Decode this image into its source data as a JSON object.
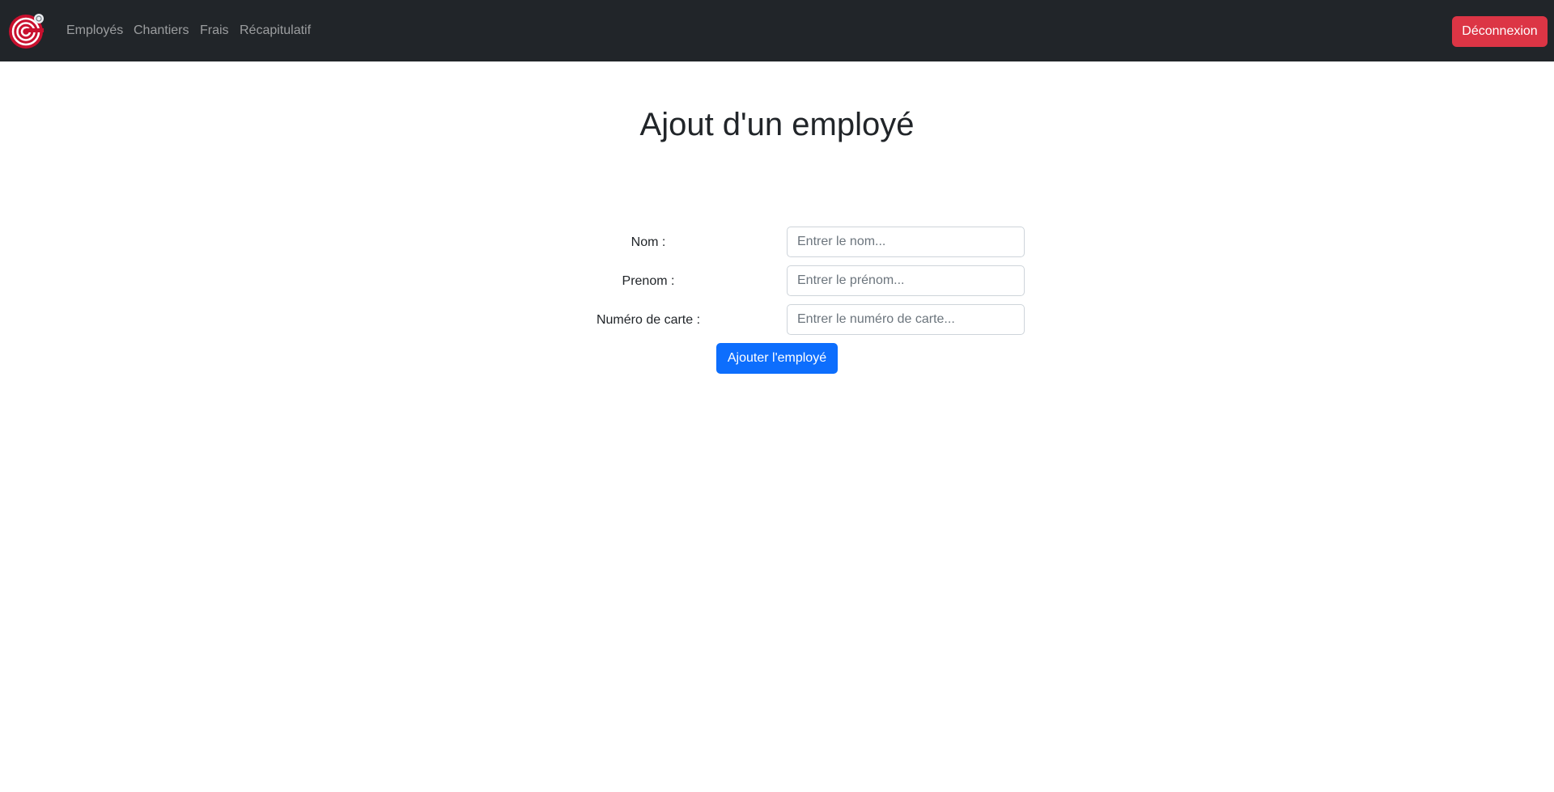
{
  "navbar": {
    "logo_icon": "company-logo-icon",
    "links": [
      {
        "label": "Employés"
      },
      {
        "label": "Chantiers"
      },
      {
        "label": "Frais"
      },
      {
        "label": "Récapitulatif"
      }
    ],
    "logout_label": "Déconnexion"
  },
  "page": {
    "title": "Ajout d'un employé"
  },
  "form": {
    "nom": {
      "label": "Nom :",
      "placeholder": "Entrer le nom...",
      "value": ""
    },
    "prenom": {
      "label": "Prenom :",
      "placeholder": "Entrer le prénom...",
      "value": ""
    },
    "numero_carte": {
      "label": "Numéro de carte :",
      "placeholder": "Entrer le numéro de carte...",
      "value": ""
    },
    "submit_label": "Ajouter l'employé"
  },
  "colors": {
    "navbar_bg": "#212529",
    "danger": "#dc3545",
    "primary": "#0d6efd",
    "logo_red": "#c8102e"
  }
}
